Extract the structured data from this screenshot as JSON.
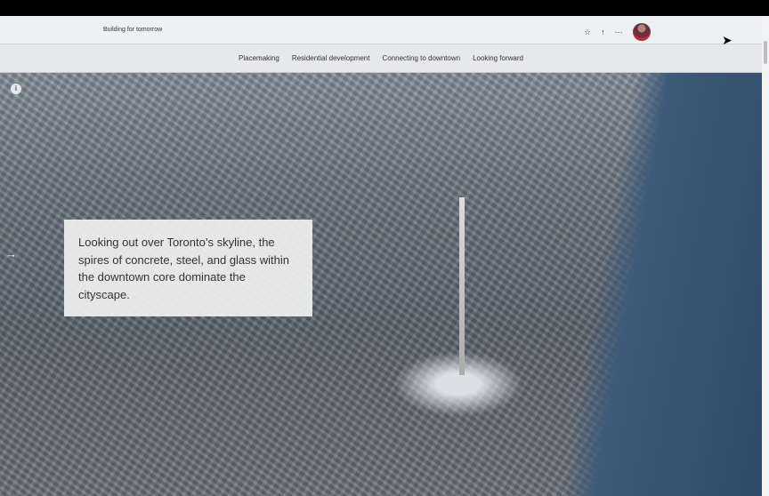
{
  "header": {
    "title": "Building for tomorrow",
    "icons": [
      "star-icon",
      "share-icon",
      "more-icon",
      "avatar"
    ]
  },
  "nav": {
    "items": [
      "Placemaking",
      "Residential development",
      "Connecting to downtown",
      "Looking forward"
    ]
  },
  "hero": {
    "info_icon": "i",
    "arrow": "→",
    "caption": "Looking out over Toronto’s skyline, the spires of concrete, steel, and glass within the downtown core dominate the cityscape."
  }
}
